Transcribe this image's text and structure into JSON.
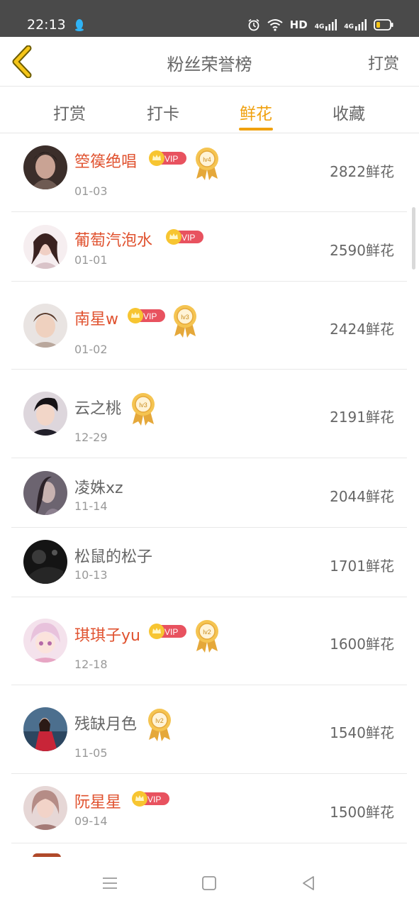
{
  "status_bar": {
    "time": "22:13",
    "hd_label": "HD",
    "network_1": "4G",
    "network_2": "4G",
    "icons": [
      "qq-icon",
      "alarm-icon",
      "wifi-icon",
      "signal-icon",
      "battery-icon"
    ]
  },
  "header": {
    "title": "粉丝荣誉榜",
    "action_label": "打赏",
    "back_icon": "chevron-left-icon"
  },
  "tabs": [
    {
      "label": "打赏",
      "active": false
    },
    {
      "label": "打卡",
      "active": false
    },
    {
      "label": "鲜花",
      "active": true
    },
    {
      "label": "收藏",
      "active": false
    }
  ],
  "accent_color": "#f0a10f",
  "vip_name_color": "#e0522f",
  "vip_badge_text": "VIP",
  "entries": [
    {
      "name": "箜篌绝唱",
      "date": "01-03",
      "flowers": "2822鲜花",
      "vip": true,
      "level": "lv4"
    },
    {
      "name": "葡萄汽泡水",
      "date": "01-01",
      "flowers": "2590鲜花",
      "vip": true,
      "level": ""
    },
    {
      "name": "南星w",
      "date": "01-02",
      "flowers": "2424鲜花",
      "vip": true,
      "level": "lv3"
    },
    {
      "name": "云之桃",
      "date": "12-29",
      "flowers": "2191鲜花",
      "vip": false,
      "level": "lv3"
    },
    {
      "name": "凌姝xz",
      "date": "11-14",
      "flowers": "2044鲜花",
      "vip": false,
      "level": ""
    },
    {
      "name": "松鼠的松子",
      "date": "10-13",
      "flowers": "1701鲜花",
      "vip": false,
      "level": ""
    },
    {
      "name": "琪琪子yu",
      "date": "12-18",
      "flowers": "1600鲜花",
      "vip": true,
      "level": "lv2"
    },
    {
      "name": "残缺月色",
      "date": "11-05",
      "flowers": "1540鲜花",
      "vip": false,
      "level": "lv2"
    },
    {
      "name": "阮星星",
      "date": "09-14",
      "flowers": "1500鲜花",
      "vip": true,
      "level": ""
    }
  ],
  "nav_bar": {
    "icons": [
      "menu-icon",
      "home-icon",
      "back-triangle-icon"
    ]
  }
}
